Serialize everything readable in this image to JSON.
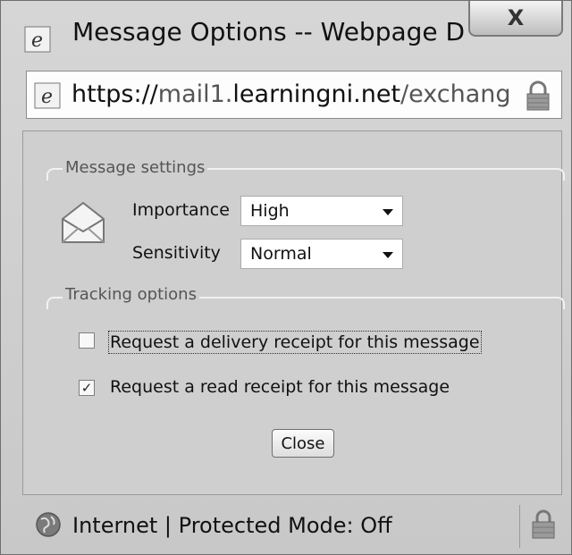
{
  "window": {
    "title": "Message Options -- Webpage D...",
    "close_glyph": "X"
  },
  "address": {
    "protocol": "https://",
    "host_prefix": "mail1.",
    "domain": "learningni.net",
    "path": "/exchang"
  },
  "message_settings": {
    "group_label": "Message settings",
    "importance_label": "Importance",
    "importance_value": "High",
    "sensitivity_label": "Sensitivity",
    "sensitivity_value": "Normal"
  },
  "tracking": {
    "group_label": "Tracking options",
    "delivery_receipt": {
      "label": "Request a delivery receipt for this message",
      "checked": false
    },
    "read_receipt": {
      "label": "Request a read receipt for this message",
      "checked": true,
      "check_glyph": "✓"
    }
  },
  "close_button_label": "Close",
  "status": {
    "text": "Internet | Protected Mode: Off"
  },
  "icons": [
    "ie-icon",
    "lock-icon",
    "envelope-icon",
    "globe-icon"
  ]
}
